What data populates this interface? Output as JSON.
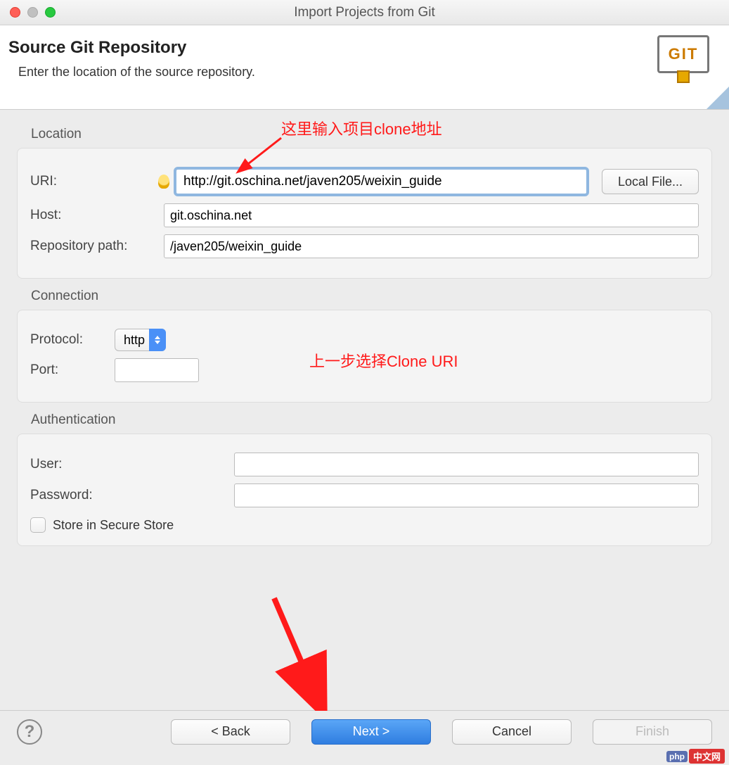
{
  "window": {
    "title": "Import Projects from Git"
  },
  "header": {
    "heading": "Source Git Repository",
    "subheading": "Enter the location of the source repository.",
    "logo_text": "GIT"
  },
  "annotations": {
    "uri_hint": "这里输入项目clone地址",
    "conn_hint": "上一步选择Clone URI"
  },
  "location": {
    "group_label": "Location",
    "uri_label": "URI:",
    "uri_value": "http://git.oschina.net/javen205/weixin_guide",
    "local_file_label": "Local File...",
    "host_label": "Host:",
    "host_value": "git.oschina.net",
    "repo_label": "Repository path:",
    "repo_value": "/javen205/weixin_guide"
  },
  "connection": {
    "group_label": "Connection",
    "protocol_label": "Protocol:",
    "protocol_value": "http",
    "port_label": "Port:",
    "port_value": ""
  },
  "auth": {
    "group_label": "Authentication",
    "user_label": "User:",
    "user_value": "",
    "password_label": "Password:",
    "password_value": "",
    "store_label": "Store in Secure Store"
  },
  "footer": {
    "back_label": "< Back",
    "next_label": "Next >",
    "cancel_label": "Cancel",
    "finish_label": "Finish"
  },
  "watermark": {
    "php": "php",
    "cn": "中文网"
  }
}
